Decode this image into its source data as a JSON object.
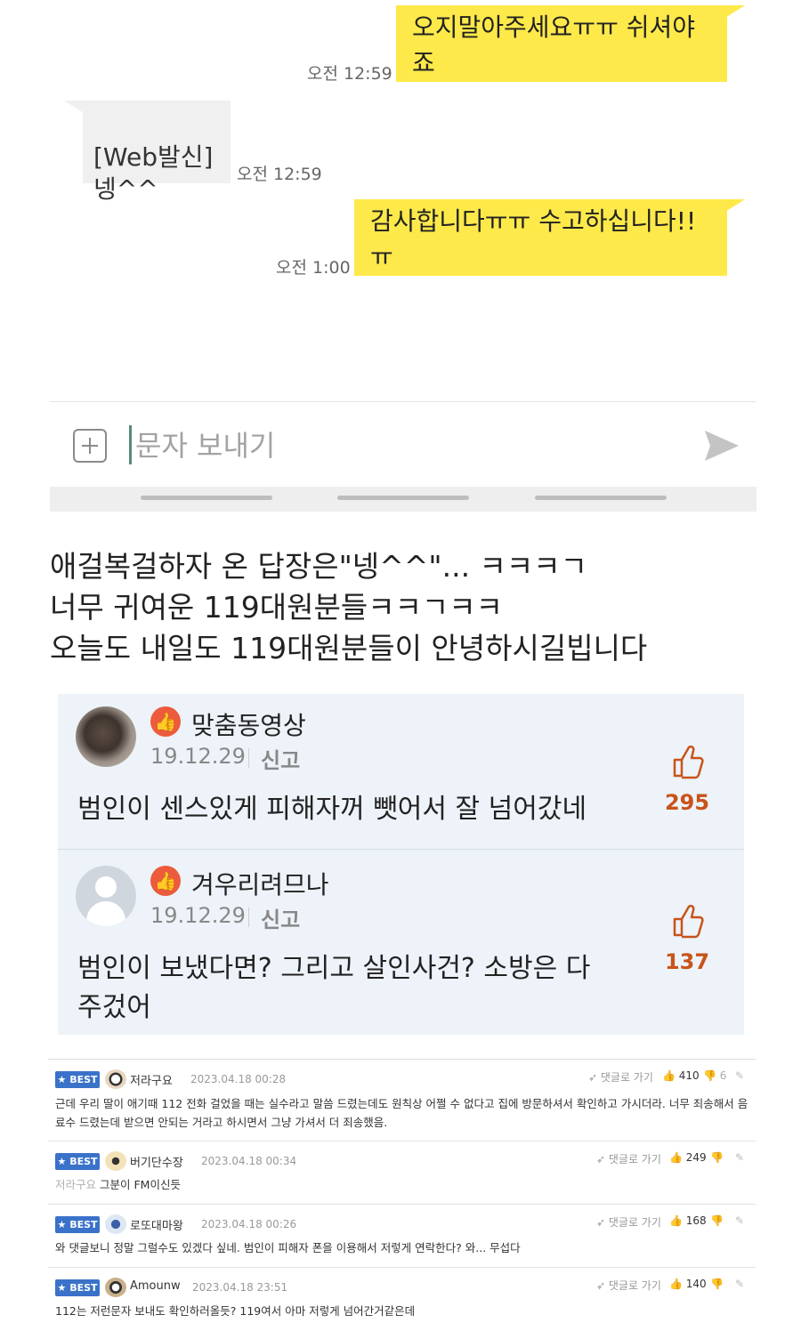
{
  "chat": {
    "sent_1": {
      "text": "오지말아주세요ㅠㅠ 쉬셔야죠",
      "time": "오전 12:59"
    },
    "received_1": {
      "text": "[Web발신]\n넹^^",
      "time": "오전 12:59"
    },
    "sent_2": {
      "text": "감사합니다ㅠㅠ 수고하십니다!!ㅠ",
      "time": "오전 1:00"
    },
    "composer": {
      "placeholder": "문자 보내기"
    }
  },
  "caption": {
    "line1": "애걸복걸하자 온 답장은\"넹^^\"... ㅋㅋㅋㄱ",
    "line2": "너무 귀여운 119대원분들ㅋㅋㄱㅋㅋ",
    "line3": "오늘도 내일도 119대원분들이 안녕하시길빕니다"
  },
  "comments": [
    {
      "name": "맞춤동영상",
      "date": "19.12.29",
      "report": "신고",
      "text": "범인이 센스있게 피해자꺼 뺏어서 잘 넘어갔네",
      "likes": "295"
    },
    {
      "name": "겨우리려므나",
      "date": "19.12.29",
      "report": "신고",
      "text": "범인이 보냈다면? 그리고 살인사건? 소방은 다 주겄어",
      "likes": "137"
    }
  ],
  "best_comments": [
    {
      "badge": "BEST",
      "user": "저라구요",
      "date": "2023.04.18 00:28",
      "reply": "댓글로 가기",
      "likes": "410",
      "dislikes": "6",
      "text": "근데 우리 딸이 애기때 112 전화 걸었을 때는 실수라고 말씀 드렸는데도 원칙상 어쩔 수 없다고 집에 방문하셔서 확인하고 가시더라. 너무 죄송해서 음료수 드렸는데 받으면 안되는 거라고 하시면서 그냥 가셔서 더 죄송했음."
    },
    {
      "badge": "BEST",
      "user": "버기단수장",
      "date": "2023.04.18 00:34",
      "reply": "댓글로 가기",
      "likes": "249",
      "ref": "저라구요",
      "text": "그분이 FM이신듯"
    },
    {
      "badge": "BEST",
      "user": "로또대마왕",
      "date": "2023.04.18 00:26",
      "reply": "댓글로 가기",
      "likes": "168",
      "text": "와 댓글보니 정말 그럴수도 있겠다 싶네. 범인이 피해자 폰을 이용해서 저렇게 연락한다? 와... 무섭다"
    },
    {
      "badge": "BEST",
      "user": "Amounw",
      "date": "2023.04.18 23:51",
      "reply": "댓글로 가기",
      "likes": "140",
      "text": "112는 저런문자 보내도 확인하러올듯? 119여서 아마 저렇게 넘어간거같은데"
    }
  ]
}
